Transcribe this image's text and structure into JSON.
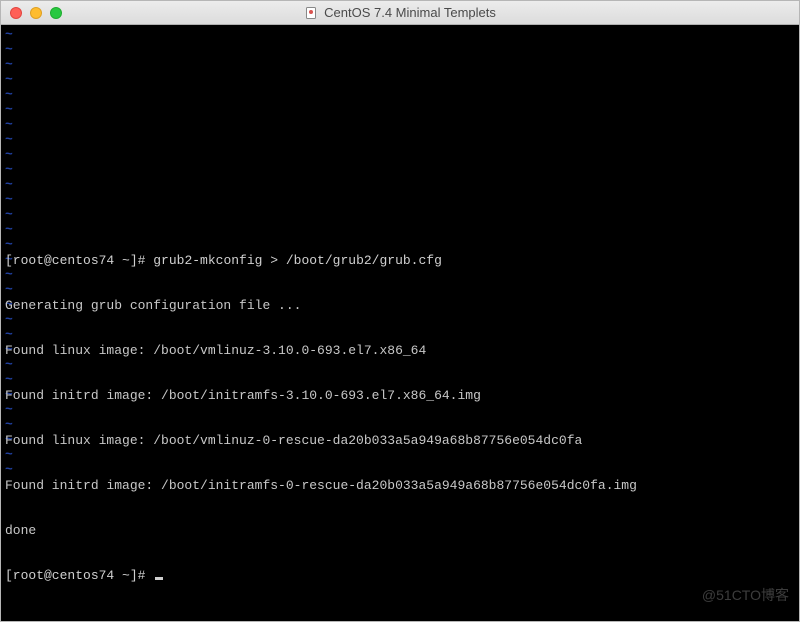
{
  "window": {
    "title": "CentOS 7.4 Minimal Templets"
  },
  "terminal": {
    "tilde_count": 30,
    "prompt1_user": "[root@centos74 ~]# ",
    "command1": "grub2-mkconfig > /boot/grub2/grub.cfg",
    "out1": "Generating grub configuration file ...",
    "out2": "Found linux image: /boot/vmlinuz-3.10.0-693.el7.x86_64",
    "out3": "Found initrd image: /boot/initramfs-3.10.0-693.el7.x86_64.img",
    "out4": "Found linux image: /boot/vmlinuz-0-rescue-da20b033a5a949a68b87756e054dc0fa",
    "out5": "Found initrd image: /boot/initramfs-0-rescue-da20b033a5a949a68b87756e054dc0fa.img",
    "out6": "done",
    "prompt2_user": "[root@centos74 ~]# "
  },
  "watermark": "@51CTO博客"
}
